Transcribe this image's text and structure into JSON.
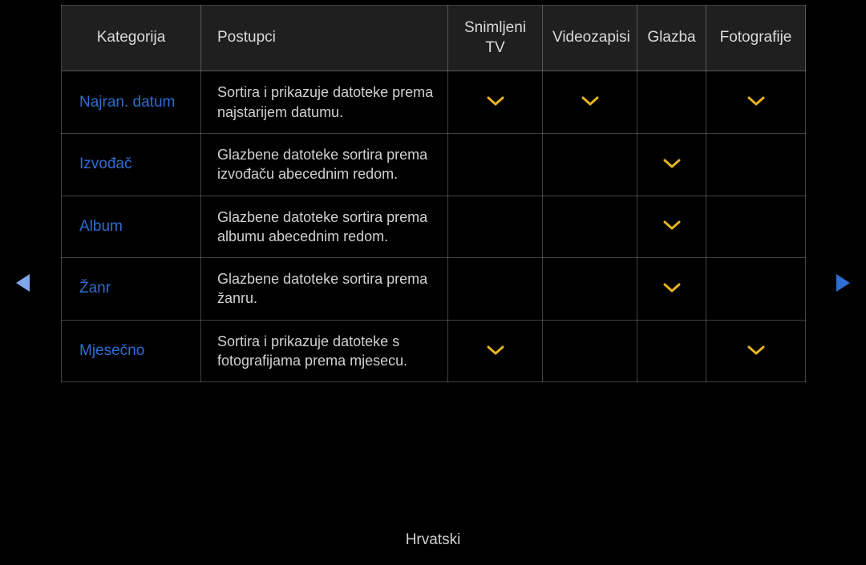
{
  "headers": {
    "category": "Kategorija",
    "procedures": "Postupci",
    "recordedTv": "Snimljeni TV",
    "videos": "Videozapisi",
    "music": "Glazba",
    "photos": "Fotografije"
  },
  "rows": [
    {
      "category": "Najran. datum",
      "procedure": "Sortira i prikazuje datoteke prema najstarijem datumu.",
      "recordedTv": true,
      "videos": true,
      "music": false,
      "photos": true
    },
    {
      "category": "Izvođač",
      "procedure": "Glazbene datoteke sortira prema izvođaču abecednim redom.",
      "recordedTv": false,
      "videos": false,
      "music": true,
      "photos": false
    },
    {
      "category": "Album",
      "procedure": "Glazbene datoteke sortira prema albumu abecednim redom.",
      "recordedTv": false,
      "videos": false,
      "music": true,
      "photos": false
    },
    {
      "category": "Žanr",
      "procedure": "Glazbene datoteke sortira prema žanru.",
      "recordedTv": false,
      "videos": false,
      "music": true,
      "photos": false
    },
    {
      "category": "Mjesečno",
      "procedure": "Sortira i prikazuje datoteke s fotografijama prema mjesecu.",
      "recordedTv": true,
      "videos": false,
      "music": false,
      "photos": true
    }
  ],
  "footer": {
    "language": "Hrvatski"
  },
  "colors": {
    "checkIcon": "#e6b422",
    "categoryText": "#2e6dd2"
  }
}
